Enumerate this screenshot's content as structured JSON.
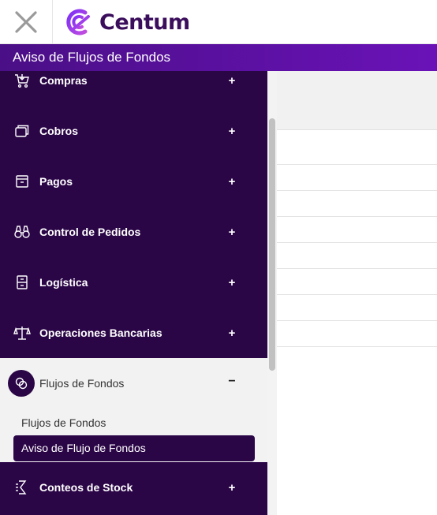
{
  "app": {
    "brand": "Centum",
    "page_title": "Aviso de Flujos de Fondos"
  },
  "colors": {
    "brand_purple": "#3b0e5c",
    "sidebar_bg": "#2b0647",
    "titlebar_accent": "#6a12b8"
  },
  "sidebar": {
    "items": [
      {
        "label": "Compras",
        "icon": "shopping-cart-icon",
        "toggle": "+"
      },
      {
        "label": "Cobros",
        "icon": "cards-icon",
        "toggle": "+"
      },
      {
        "label": "Pagos",
        "icon": "archive-box-icon",
        "toggle": "+"
      },
      {
        "label": "Control de Pedidos",
        "icon": "binoculars-icon",
        "toggle": "+"
      },
      {
        "label": "Logística",
        "icon": "cabinet-icon",
        "toggle": "+"
      },
      {
        "label": "Operaciones Bancarias",
        "icon": "scales-icon",
        "toggle": "+"
      }
    ],
    "open_group": {
      "label": "Flujos de Fondos",
      "icon": "coins-icon",
      "toggle": "−",
      "sub_items": [
        {
          "label": "Flujos de Fondos",
          "active": false
        },
        {
          "label": "Aviso de Flujo de Fondos",
          "active": true
        }
      ]
    },
    "after_items": [
      {
        "label": "Conteos de Stock",
        "icon": "stock-count-icon",
        "toggle": "+"
      }
    ]
  }
}
